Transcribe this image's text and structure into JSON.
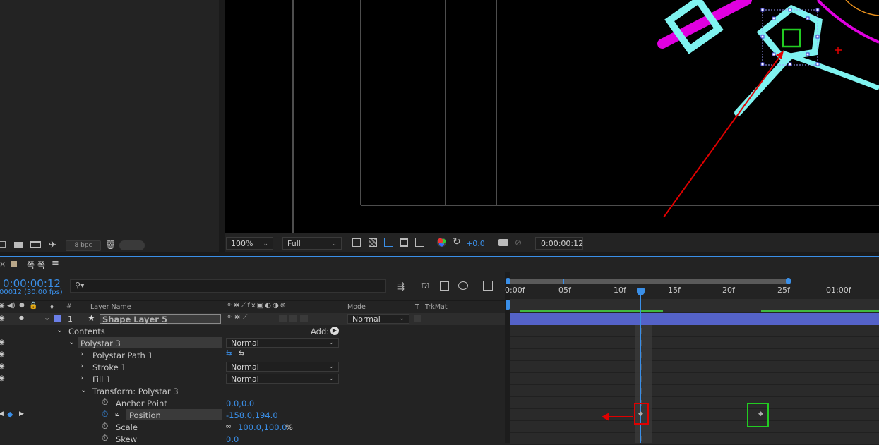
{
  "project_panel": {
    "bpc_label": "8 bpc"
  },
  "composition_viewer": {
    "zoom": "100%",
    "resolution": "Full",
    "exposure": "+0.0",
    "timecode": "0:00:00:12"
  },
  "timeline_panel": {
    "tab_label": "쪽 쪽",
    "current_time": "0:00:00:12",
    "frame_readout": "00012 (30.00 fps)",
    "search_placeholder": "",
    "columns": {
      "num": "#",
      "layer_name": "Layer Name",
      "mode": "Mode",
      "t": "T",
      "trkmat": "TrkMat"
    },
    "ruler": [
      "0:00f",
      "05f",
      "10f",
      "15f",
      "20f",
      "25f",
      "01:00f"
    ],
    "layer": {
      "number": "1",
      "name": "Shape Layer 5",
      "mode": "Normal"
    },
    "tree": {
      "contents": "Contents",
      "add_label": "Add:",
      "polystar": "Polystar 3",
      "polystar_mode": "Normal",
      "polystar_path": "Polystar Path 1",
      "stroke": "Stroke 1",
      "stroke_mode": "Normal",
      "fill": "Fill 1",
      "fill_mode": "Normal",
      "transform": "Transform: Polystar 3",
      "anchor_point": "Anchor Point",
      "anchor_value": "0.0,0.0",
      "position": "Position",
      "position_value": "-158.0,194.0",
      "scale": "Scale",
      "scale_value": "100.0,100.0",
      "scale_unit": "%",
      "skew": "Skew",
      "skew_value": "0.0"
    }
  },
  "colors": {
    "accent_blue": "#3a8fe8",
    "shape_cyan": "#7ff3f0",
    "shape_magenta": "#e000e0",
    "annotation_red": "#e00000",
    "annotation_green": "#22cc22",
    "layer_bar": "#5462c8"
  }
}
